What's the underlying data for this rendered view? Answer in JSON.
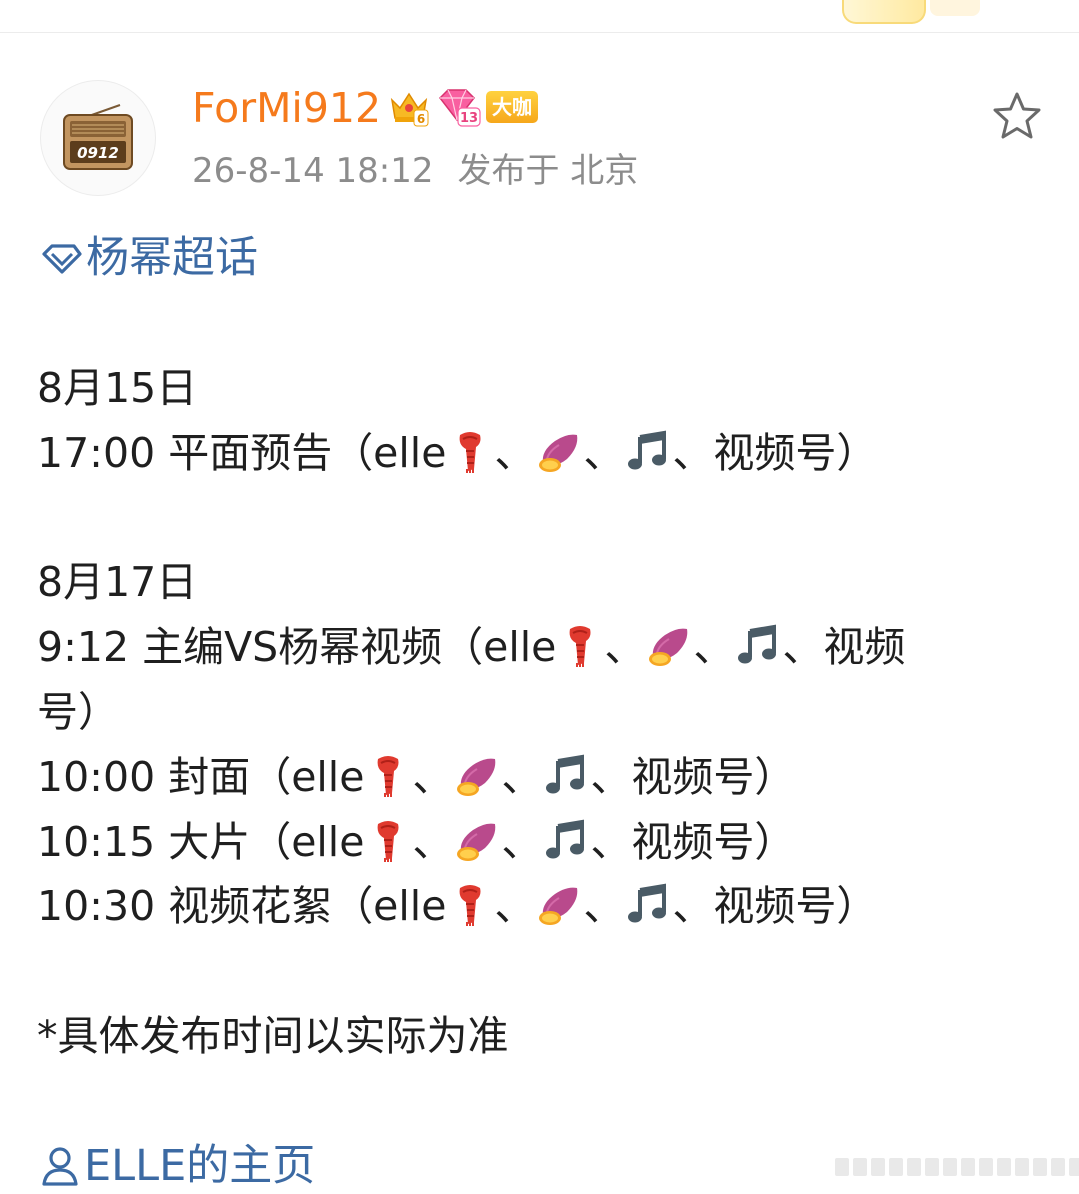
{
  "post": {
    "username": "ForMi912",
    "badge_label": "大咖",
    "crown_level": "6",
    "gem_level": "13",
    "date": "26-8-14 18:12",
    "location": "发布于 北京",
    "avatar_text": "0912",
    "topic": "杨幂超话",
    "homepage_link": "ELLE的主页"
  },
  "content": {
    "date1": "8月15日",
    "d1_line": "17:00 平面预告（elle",
    "date2": "8月17日",
    "d2_line1": "9:12 主编VS杨幂视频（elle",
    "d2_line1_tail": "、视频",
    "d2_line1_wrap": "号）",
    "d2_line2": "10:00 封面（elle",
    "d2_line3": "10:15 大片（elle",
    "d2_line4": "10:30 视频花絮（elle",
    "platform_end": "、视频号）",
    "separator": "、",
    "note": "*具体发布时间以实际为准"
  },
  "icons": {
    "scarf": "scarf-emoji",
    "sweet_potato": "sweet-potato-emoji",
    "music": "musical-note-emoji",
    "star": "star-outline-icon",
    "topic": "supertopic-diamond-icon",
    "person": "person-icon"
  },
  "colors": {
    "username": "#f57a1c",
    "link": "#3c6aa3",
    "meta": "#8c8c8c"
  }
}
